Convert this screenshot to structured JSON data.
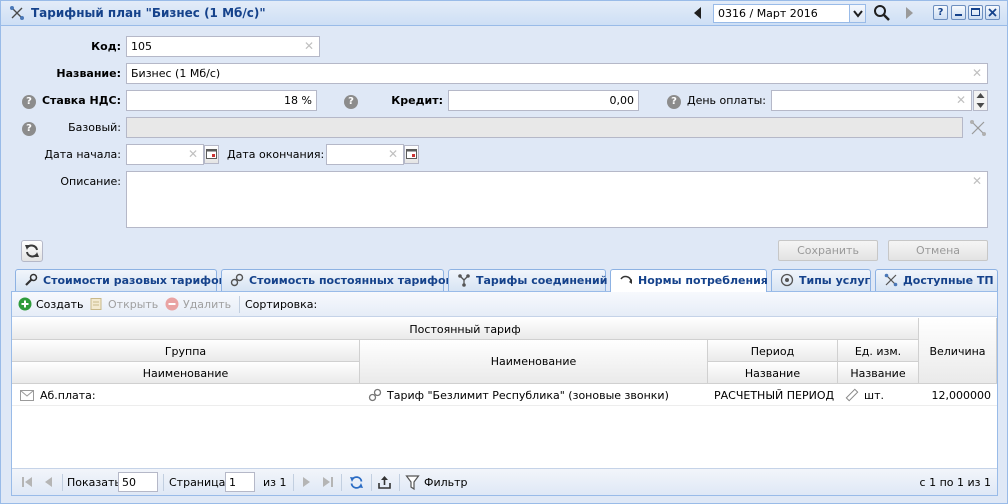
{
  "window": {
    "title": "Тарифный план \"Бизнес (1 Мб/с)\"",
    "period_value": "0316 / Март 2016",
    "help_label": "?"
  },
  "form": {
    "code": {
      "label": "Код:",
      "value": "105"
    },
    "name": {
      "label": "Название:",
      "value": "Бизнес (1 Мб/с)"
    },
    "vat": {
      "label": "Ставка НДС:",
      "value": "18 %"
    },
    "credit": {
      "label": "Кредит:",
      "value": "0,00"
    },
    "payment_day": {
      "label": "День оплаты:",
      "value": ""
    },
    "base": {
      "label": "Базовый:",
      "value": ""
    },
    "start_date": {
      "label": "Дата начала:",
      "value": ""
    },
    "end_date": {
      "label": "Дата окончания:",
      "value": ""
    },
    "description": {
      "label": "Описание:",
      "value": ""
    },
    "save_label": "Сохранить",
    "cancel_label": "Отмена"
  },
  "tabs": [
    {
      "label": "Стоимости разовых тарифов",
      "icon": "wrench-icon"
    },
    {
      "label": "Стоимость постоянных тарифов",
      "icon": "link-icon"
    },
    {
      "label": "Тарифы соединений",
      "icon": "connections-icon"
    },
    {
      "label": "Нормы потребления",
      "icon": "consumption-icon",
      "active": true
    },
    {
      "label": "Типы услуг",
      "icon": "service-types-icon"
    },
    {
      "label": "Доступные ТП",
      "icon": "tariff-plans-icon"
    }
  ],
  "toolbar": {
    "create": "Создать",
    "open": "Открыть",
    "delete": "Удалить",
    "sort": "Сортировка:"
  },
  "grid": {
    "headers": {
      "permanent_tariff": "Постоянный тариф",
      "group": "Группа",
      "group_name": "Наименование",
      "name": "Наименование",
      "period": "Период",
      "period_name": "Название",
      "unit": "Ед. изм.",
      "unit_name": "Название",
      "value": "Величина"
    },
    "rows": [
      {
        "group_name": "Аб.плата:",
        "name": "Тариф \"Безлимит Республика\" (зоновые звонки)",
        "period_name": "РАСЧЕТНЫЙ ПЕРИОД",
        "unit_name": "шт.",
        "value": "12,000000"
      }
    ]
  },
  "pager": {
    "show_label": "Показать",
    "page_size": "50",
    "page_label": "Страница",
    "page_value": "1",
    "of_label": "из 1",
    "filter_label": "Фильтр",
    "summary": "с 1 по 1 из 1"
  },
  "colors": {
    "title_text": "#15428b",
    "panel_bg": "#dfe8f6",
    "border": "#99bbe8",
    "create_icon": "#2e9b3a"
  }
}
